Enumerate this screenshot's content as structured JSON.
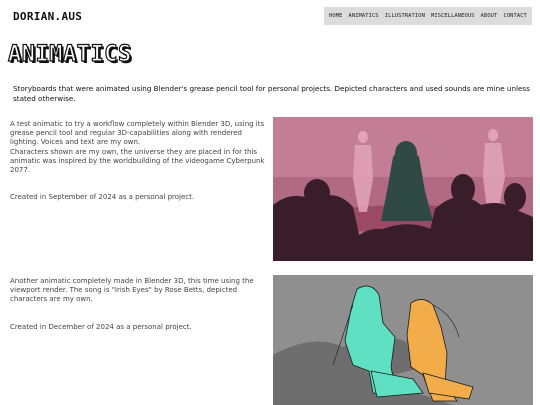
{
  "site": {
    "logo": "DORIAN.AUS"
  },
  "nav": {
    "items": [
      {
        "label": "HOME"
      },
      {
        "label": "ANIMATICS"
      },
      {
        "label": "ILLUSTRATION"
      },
      {
        "label": "MISCELLANEOUS"
      },
      {
        "label": "ABOUT"
      },
      {
        "label": "CONTACT"
      }
    ]
  },
  "page": {
    "title": "ANIMATICS",
    "intro": "Storyboards that were animated using Blender's grease pencil tool for personal projects. Depicted characters and used sounds are mine unless stated otherwise."
  },
  "projects": [
    {
      "lines": [
        "A test animatic to try a workflow completely within Blender 3D, using its grease pencil tool and regular 3D-capabilities along with rendered lighting. Voices and text are my own.",
        "Characters shown are my own, the universe they are placed in for this animatic was inspired by the worldbuilding of the videogame Cyberpunk 2077."
      ],
      "date": "Created in September of 2024 as a personal project.",
      "colors": {
        "bg": "#b26a83",
        "floor": "#9b4a66",
        "silhouette": "#3a1d2a",
        "figure": "#2e4a43",
        "accent": "#e2a3b8"
      }
    },
    {
      "lines": [
        "Another animatic completely made in Blender 3D, this time using the viewport render. The song is \"Irish Eyes\" by Rose Betts, depicted characters are my own."
      ],
      "date": "Created in December of 2024 as a personal project.",
      "colors": {
        "bg": "#8f8f8f",
        "ground": "#6e6e6e",
        "figure1": "#5fe0c2",
        "figure2": "#f2ad4a",
        "line": "#1b1b1b"
      }
    }
  ]
}
